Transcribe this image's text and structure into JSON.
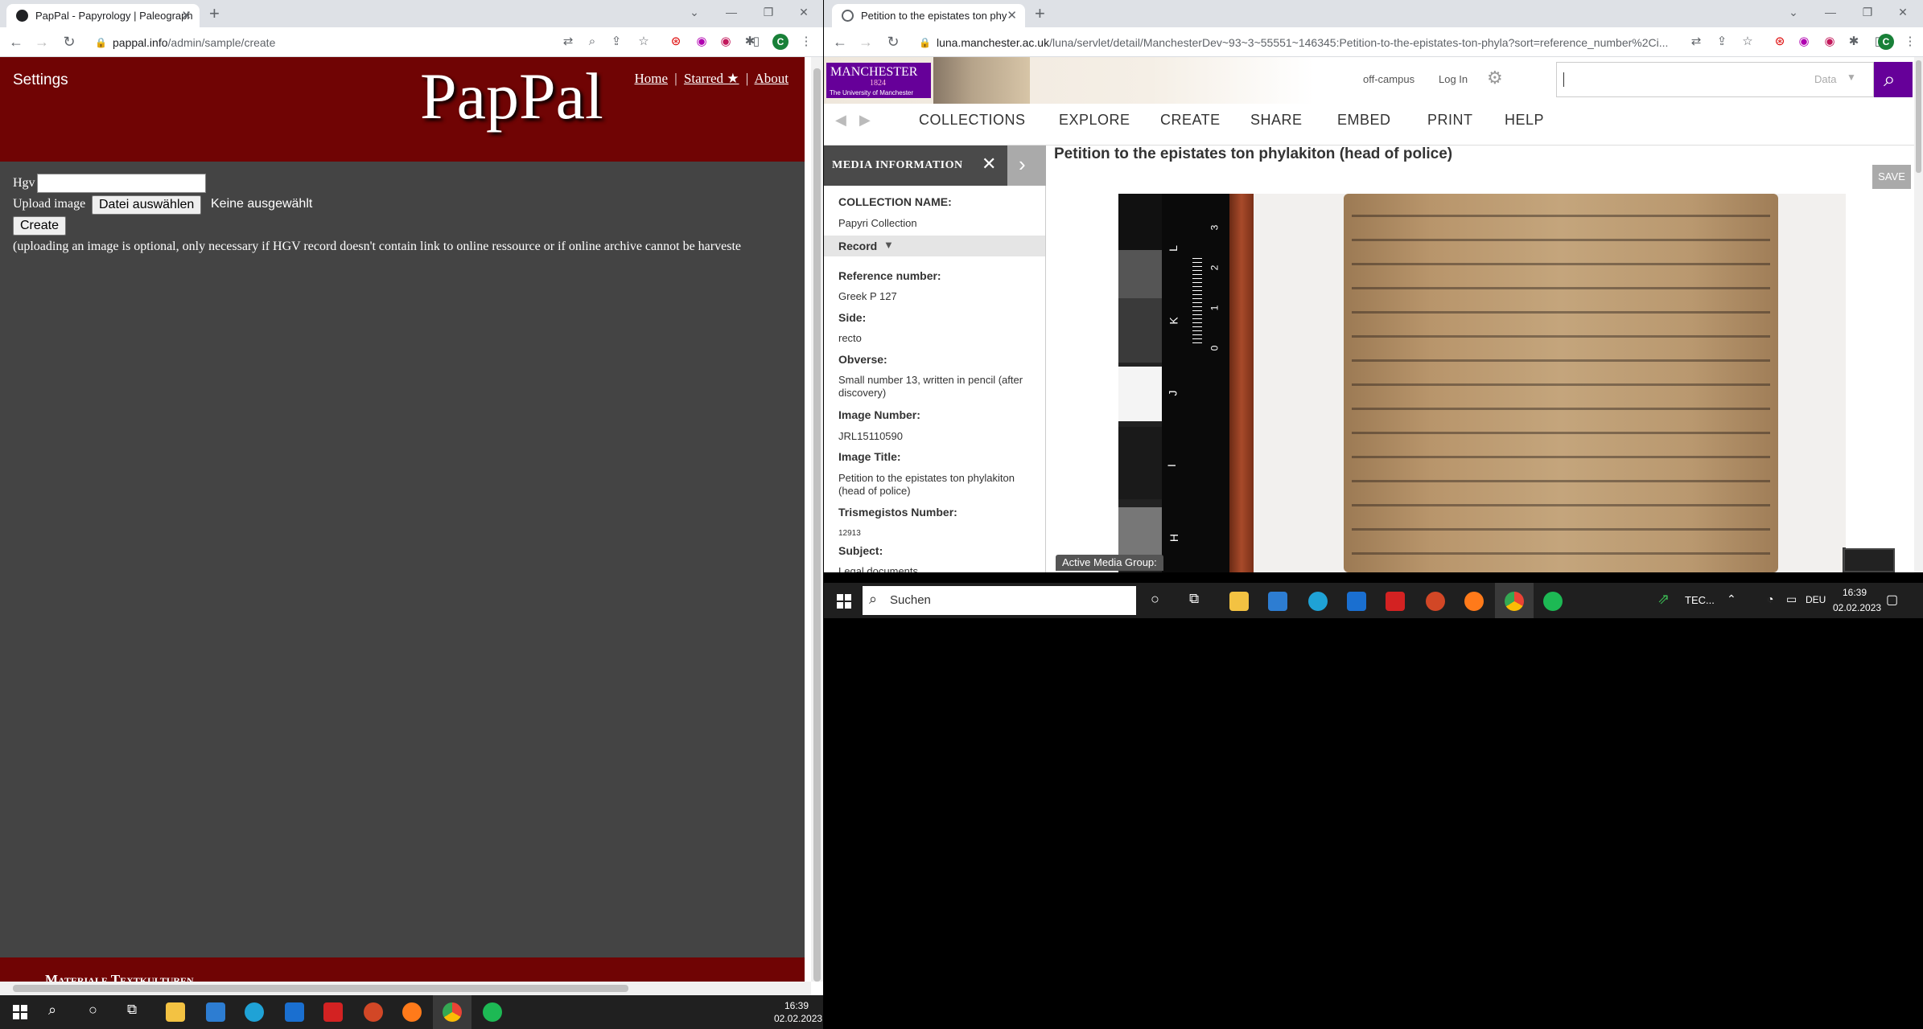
{
  "left_browser": {
    "tab_title": "PapPal - Papyrology | Paleograph",
    "url_host": "pappal.info",
    "url_path": "/admin/sample/create",
    "page": {
      "settings_label": "Settings",
      "logo": "PapPal",
      "nav": {
        "home": "Home",
        "sep1": "|",
        "starred": "Starred ★",
        "sep2": "|",
        "about": "About"
      },
      "hgv_label": "Hgv",
      "upload_label": "Upload image",
      "file_button": "Datei auswählen",
      "file_status": "Keine ausgewählt",
      "create_button": "Create",
      "note": "(uploading an image is optional, only necessary if HGV record doesn't contain link to online ressource or if online archive cannot be harveste",
      "footer_text": "Materiale Textkulturen"
    }
  },
  "right_browser": {
    "tab_title": "Petition to the epistates ton phy",
    "url_host": "luna.manchester.ac.uk",
    "url_path": "/luna/servlet/detail/ManchesterDev~93~3~55551~146345:Petition-to-the-epistates-ton-phyla?sort=reference_number%2Ci...",
    "header": {
      "logo_name": "MANCHESTER",
      "logo_year": "1824",
      "logo_sub": "The University of Manchester",
      "off_campus": "off-campus",
      "log_in": "Log In",
      "search_scope": "Data"
    },
    "nav": [
      "COLLECTIONS",
      "EXPLORE",
      "CREATE",
      "SHARE",
      "EMBED",
      "PRINT",
      "HELP"
    ],
    "media_info_title": "MEDIA INFORMATION",
    "record_toggle": "Record",
    "fields": [
      {
        "label": "COLLECTION NAME:",
        "value": "Papyri Collection"
      },
      {
        "label": "Reference number:",
        "value": "Greek P 127"
      },
      {
        "label": "Side:",
        "value": "recto"
      },
      {
        "label": "Obverse:",
        "value": "Small number 13, written in pencil (after discovery)"
      },
      {
        "label": "Image Number:",
        "value": "JRL15110590"
      },
      {
        "label": "Image Title:",
        "value": "Petition to the epistates ton phylakiton (head of police)"
      },
      {
        "label": "Trismegistos Number:",
        "value": "12913"
      },
      {
        "label": "Subject:",
        "value": "Legal documents"
      }
    ],
    "item_title": "Petition to the epistates ton phylakiton (head of police)",
    "save_button": "SAVE",
    "active_media_group": "Active Media Group:",
    "ruler_letters": [
      "L",
      "K",
      "J",
      "I",
      "H"
    ],
    "ruler_numbers": [
      "3",
      "2",
      "1",
      "0"
    ]
  },
  "taskbar_right": {
    "search_placeholder": "Suchen",
    "tray_text": "TEC...",
    "lang": "DEU",
    "time": "16:39",
    "date": "02.02.2023"
  },
  "taskbar_left": {
    "time": "16:39",
    "date": "02.02.2023"
  },
  "colors": {
    "pappal_red": "#700404",
    "pappal_body": "#444444",
    "manchester_purple": "#660099"
  }
}
